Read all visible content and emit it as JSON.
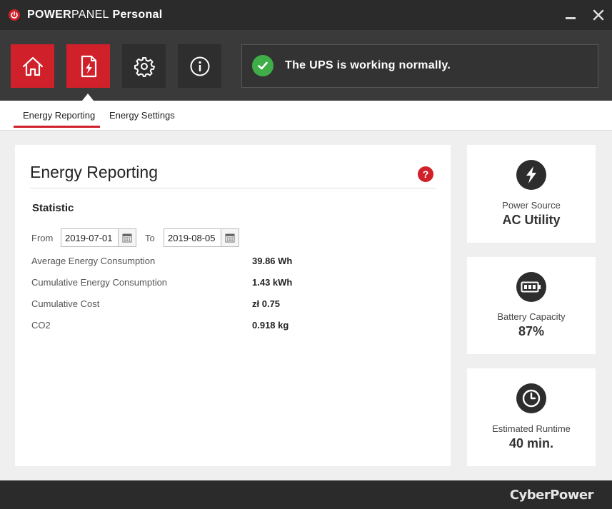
{
  "app": {
    "title_part1": "POWER",
    "title_part2": "PANEL",
    "title_part3": " Personal"
  },
  "toolbar": {
    "buttons": [
      {
        "name": "home",
        "icon": "home-icon",
        "active": true
      },
      {
        "name": "energy",
        "icon": "energy-report-icon",
        "active": true
      },
      {
        "name": "settings",
        "icon": "gear-icon",
        "active": false
      },
      {
        "name": "info",
        "icon": "info-icon",
        "active": false
      }
    ],
    "status_text": "The UPS is working normally."
  },
  "tabs": [
    {
      "label": "Energy Reporting",
      "active": true
    },
    {
      "label": "Energy Settings",
      "active": false
    }
  ],
  "main": {
    "title": "Energy Reporting",
    "help": "?",
    "section_title": "Statistic",
    "from_label": "From",
    "to_label": "To",
    "from_date": "2019-07-01",
    "to_date": "2019-08-05",
    "stats": [
      {
        "label": "Average Energy Consumption",
        "value": "39.86 Wh"
      },
      {
        "label": "Cumulative Energy Consumption",
        "value": "1.43 kWh"
      },
      {
        "label": "Cumulative Cost",
        "value": "zł 0.75"
      },
      {
        "label": "CO2",
        "value": "0.918 kg"
      }
    ]
  },
  "cards": {
    "power_source": {
      "label": "Power Source",
      "value": "AC Utility",
      "icon": "lightning-icon"
    },
    "battery": {
      "label": "Battery Capacity",
      "value": "87%",
      "icon": "battery-icon"
    },
    "runtime": {
      "label": "Estimated Runtime",
      "value": "40 min.",
      "icon": "clock-icon"
    }
  },
  "footer": {
    "brand": "CyberPower"
  },
  "colors": {
    "accent": "#d0202a",
    "ok": "#3fae49",
    "dark": "#2b2b2b"
  }
}
